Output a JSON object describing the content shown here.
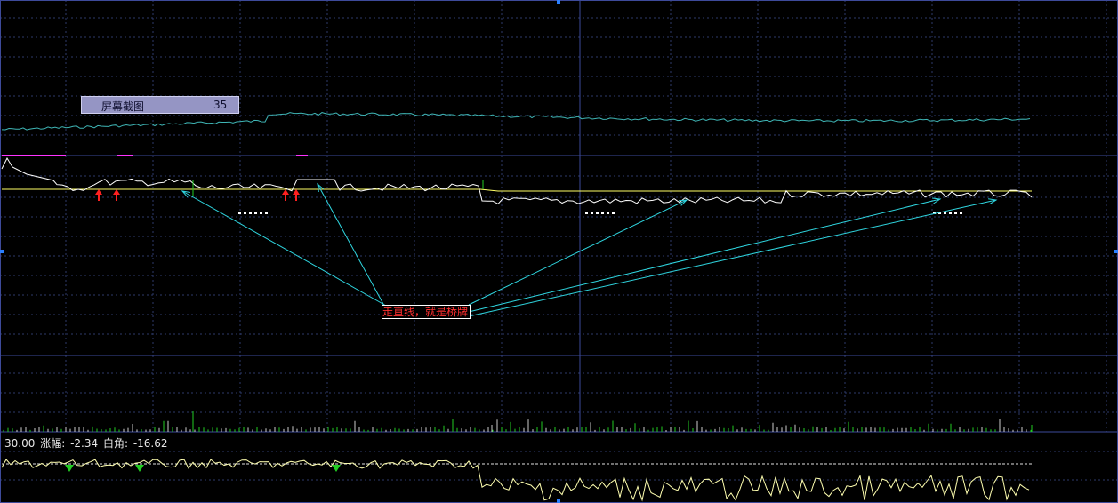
{
  "overlay_label": {
    "name": "屏幕截图",
    "value": "35"
  },
  "annotation": {
    "text": "走直线，就是桥牌"
  },
  "status": {
    "price": "30.00",
    "change_label": "涨幅:",
    "change_value": "-2.34",
    "angle_label": "白角:",
    "angle_value": "-16.62"
  },
  "colors": {
    "background": "#000000",
    "grid": "#2e3a6a",
    "frame": "#3d4a9a",
    "main_line": "#ffffff",
    "avg_line": "#ffff66",
    "indicator_line": "#3fb6b6",
    "arrow_line": "#2fd6e0",
    "up_mark": "#ff2020",
    "down_mark": "#22cc22",
    "volume_neutral": "#cccccc",
    "oscillator": "#ffffb0",
    "oscillator_alt": "#ff40ff"
  },
  "icons": [
    "up-arrow-icon",
    "down-arrow-icon"
  ]
}
